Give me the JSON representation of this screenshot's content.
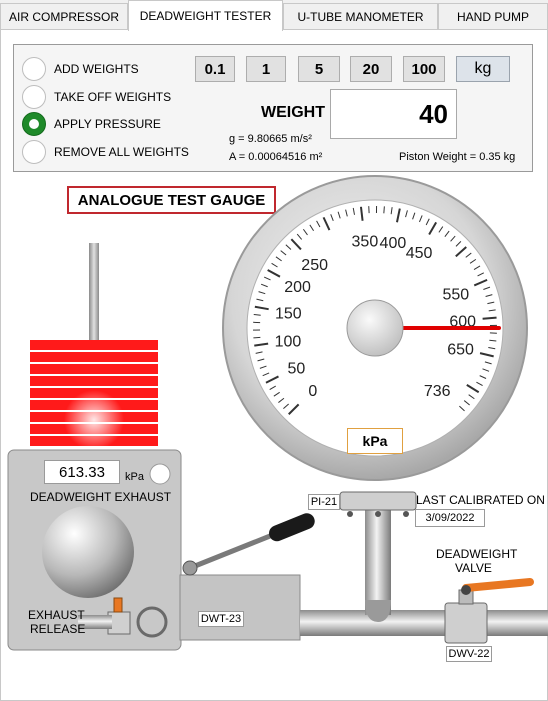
{
  "tabs": [
    {
      "label": "AIR COMPRESSOR"
    },
    {
      "label": "DEADWEIGHT TESTER"
    },
    {
      "label": "U-TUBE MANOMETER"
    },
    {
      "label": "HAND PUMP"
    }
  ],
  "radios": [
    {
      "label": "ADD  WEIGHTS"
    },
    {
      "label": "TAKE OFF WEIGHTS"
    },
    {
      "label": "APPLY PRESSURE"
    },
    {
      "label": "REMOVE ALL WEIGHTS"
    }
  ],
  "weight_buttons": [
    "0.1",
    "1",
    "5",
    "20",
    "100"
  ],
  "unit_button": "kg",
  "weight": {
    "label": "WEIGHT",
    "value": "40"
  },
  "constants": {
    "g": "g = 9.80665 m/s²",
    "A": "A = 0.00064516 m²",
    "piston": "Piston Weight = 0.35 kg"
  },
  "gauge": {
    "title": "ANALOGUE TEST GAUGE",
    "ticks": [
      "0",
      "50",
      "100",
      "150",
      "200",
      "250",
      "350",
      "400",
      "450",
      "550",
      "600",
      "650",
      "736"
    ],
    "unit": "kPa",
    "reading": 613.33,
    "max": 736
  },
  "exhaust": {
    "readout": "613.33",
    "unit": "kPa",
    "label": "DEADWEIGHT EXHAUST",
    "release_label_1": "EXHAUST",
    "release_label_2": "RELEASE"
  },
  "tags": {
    "pi": "PI-21",
    "calibrated_label": "LAST CALIBRATED ON",
    "calibrated_date": "3/09/2022",
    "dwt": "DWT-23",
    "valve_label_1": "DEADWEIGHT",
    "valve_label_2": "VALVE",
    "dwv": "DWV-22"
  },
  "colors": {
    "weights": "#ff1a1a",
    "radio_on": "#1f8a2a",
    "needle": "#e00000",
    "title_border": "#c0282e",
    "valve_handle": "#e87722"
  }
}
